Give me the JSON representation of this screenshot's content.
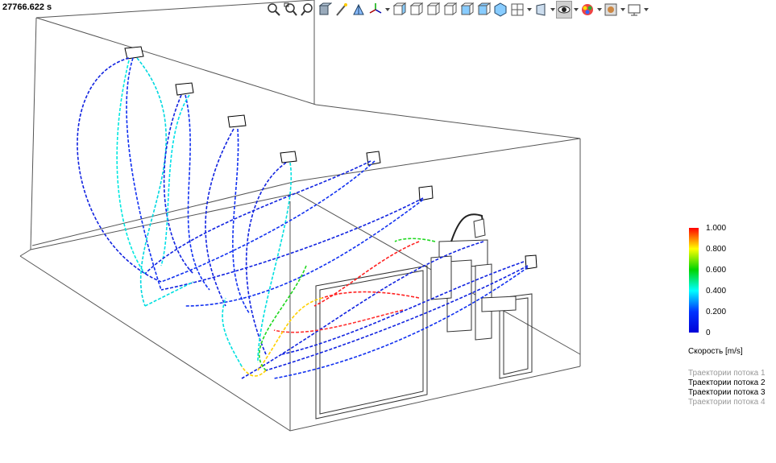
{
  "time_readout": "27766.622 s",
  "toolbar": {
    "buttons": [
      {
        "name": "zoom-to-fit-icon",
        "arrow": false,
        "active": false
      },
      {
        "name": "zoom-window-icon",
        "arrow": false,
        "active": false
      },
      {
        "name": "zoom-in-out-icon",
        "arrow": false,
        "active": false
      },
      {
        "name": "section-view-icon",
        "arrow": false,
        "active": false
      },
      {
        "name": "magic-wand-icon",
        "arrow": false,
        "active": false
      },
      {
        "name": "previous-view-icon",
        "arrow": false,
        "active": false
      },
      {
        "name": "view-orientation-icon",
        "arrow": true,
        "active": false
      },
      {
        "name": "front-view-icon",
        "arrow": false,
        "active": false
      },
      {
        "name": "back-view-icon",
        "arrow": false,
        "active": false
      },
      {
        "name": "left-view-icon",
        "arrow": false,
        "active": false
      },
      {
        "name": "right-view-icon",
        "arrow": false,
        "active": false
      },
      {
        "name": "top-view-icon",
        "arrow": false,
        "active": false
      },
      {
        "name": "bottom-view-icon",
        "arrow": false,
        "active": false
      },
      {
        "name": "isometric-view-icon",
        "arrow": false,
        "active": false
      },
      {
        "name": "view-settings-icon",
        "arrow": true,
        "active": false
      },
      {
        "name": "display-style-icon",
        "arrow": true,
        "active": false
      },
      {
        "name": "hide-show-items-icon",
        "arrow": true,
        "active": true
      },
      {
        "name": "edit-appearance-icon",
        "arrow": true,
        "active": false
      },
      {
        "name": "apply-scene-icon",
        "arrow": true,
        "active": false
      },
      {
        "name": "view-settings-monitor-icon",
        "arrow": true,
        "active": false
      }
    ]
  },
  "legend": {
    "values": [
      "1.000",
      "0.800",
      "0.600",
      "0.400",
      "0.200",
      "0"
    ],
    "title": "Скорость [m/s]",
    "colors": [
      "#ff0000",
      "#ffff00",
      "#00d400",
      "#00ffff",
      "#0033ff",
      "#0000d8"
    ]
  },
  "trajectories": [
    {
      "label": "Траектории потока 1",
      "active": false
    },
    {
      "label": "Траектории потока 2",
      "active": true
    },
    {
      "label": "Траектории потока 3",
      "active": true
    },
    {
      "label": "Траектории потока 4",
      "active": false
    }
  ]
}
